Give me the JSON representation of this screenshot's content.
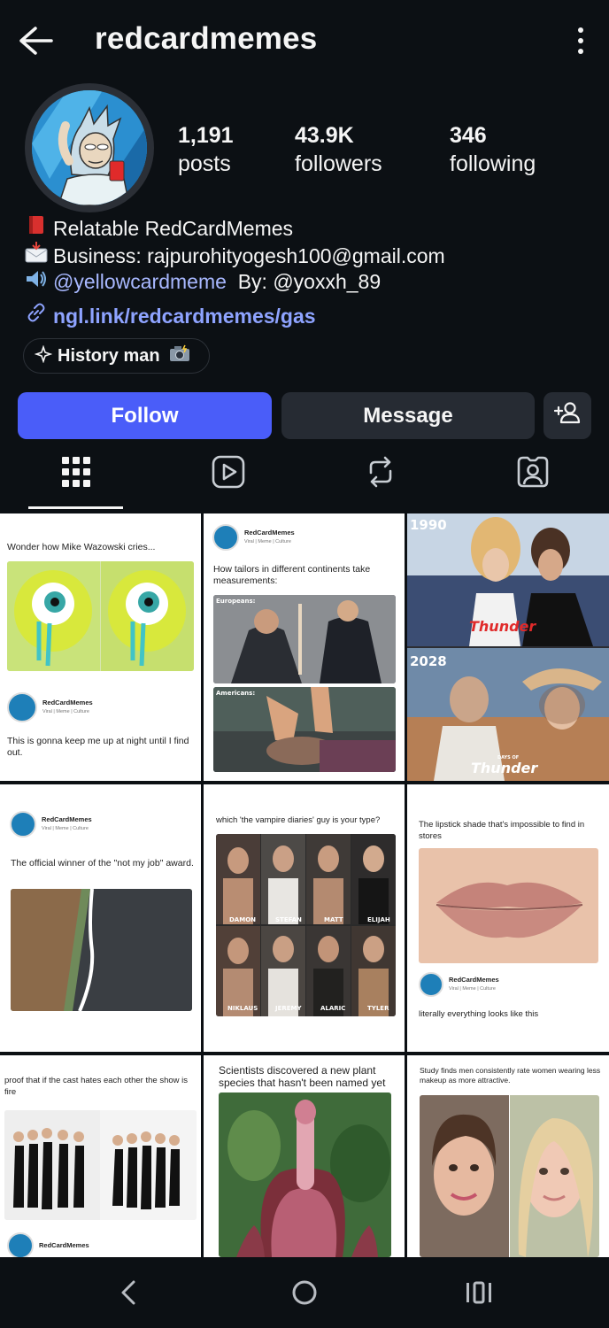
{
  "header": {
    "username": "redcardmemes"
  },
  "stats": [
    {
      "value": "1,191",
      "label": "posts"
    },
    {
      "value": "43.9K",
      "label": "followers"
    },
    {
      "value": "346",
      "label": "following"
    }
  ],
  "bio": {
    "line1": "Relatable RedCardMemes",
    "line2": "Business: rajpurohityogesh100@gmail.com",
    "mention1": "@yellowcardmeme",
    "by_label": "By:",
    "mention2": "@yoxxh_89",
    "link": "ngl.link/redcardmemes/gas"
  },
  "highlight": {
    "label": "History man"
  },
  "actions": {
    "follow": "Follow",
    "message": "Message"
  },
  "tabs": [
    {
      "name": "grid",
      "icon": "grid-icon",
      "active": true
    },
    {
      "name": "reels",
      "icon": "reels-icon",
      "active": false
    },
    {
      "name": "reposts",
      "icon": "repost-icon",
      "active": false
    },
    {
      "name": "tagged",
      "icon": "tagged-icon",
      "active": false
    }
  ],
  "posts": [
    {
      "caption": "Wonder how Mike Wazowski cries...",
      "brand": "RedCardMemes",
      "brand_sub": "Viral | Meme | Culture",
      "footer": "This is gonna keep me up at night until I find out."
    },
    {
      "brand": "RedCardMemes",
      "brand_sub": "Viral | Meme | Culture",
      "caption": "How tailors in different continents take measurements:",
      "label_a": "Europeans:",
      "label_b": "Americans:"
    },
    {
      "year_a": "1990",
      "year_b": "2028",
      "logo": "Thunder",
      "logo_b_small": "DAYS OF",
      "logo_b": "Thunder"
    },
    {
      "brand": "RedCardMemes",
      "brand_sub": "Viral | Meme | Culture",
      "caption": "The official winner of the \"not my job\" award."
    },
    {
      "caption": "which 'the vampire diaries' guy is your type?",
      "names": [
        "DAMON",
        "STEFAN",
        "MATT",
        "ELIJAH",
        "NIKLAUS",
        "JEREMY",
        "ALARIC",
        "TYLER"
      ]
    },
    {
      "caption": "The lipstick shade that's impossible to find in stores",
      "brand": "RedCardMemes",
      "brand_sub": "Viral | Meme | Culture",
      "footer": "literally everything looks like this"
    },
    {
      "caption": "proof that if the cast hates each other the show is fire",
      "brand": "RedCardMemes"
    },
    {
      "caption": "Scientists discovered a new plant species that hasn't been named yet"
    },
    {
      "caption": "Study finds men consistently rate women wearing less makeup as more attractive."
    }
  ],
  "colors": {
    "background": "#0c1014",
    "follow": "#4a5df9",
    "secondary_button": "#262b33",
    "link": "#8ea3ff"
  }
}
